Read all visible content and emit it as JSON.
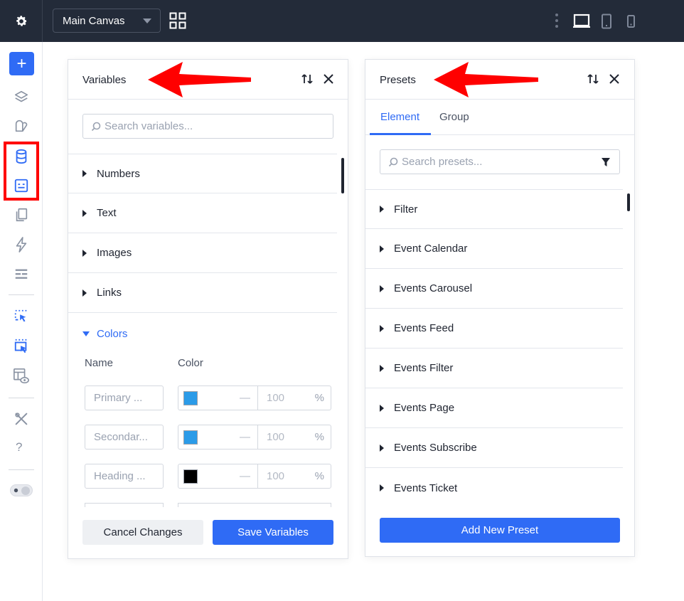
{
  "topbar": {
    "canvas_select": "Main Canvas"
  },
  "sidebar": {
    "add_label": "+",
    "help_label": "?"
  },
  "variables_panel": {
    "title": "Variables",
    "search_placeholder": "Search variables...",
    "sections": [
      "Numbers",
      "Text",
      "Images",
      "Links"
    ],
    "colors_section": "Colors",
    "col_name": "Name",
    "col_color": "Color",
    "rows": [
      {
        "name": "Primary ...",
        "swatch": "#2b9be8",
        "dash": "—",
        "opacity": "100",
        "unit": "%"
      },
      {
        "name": "Secondar...",
        "swatch": "#2b9be8",
        "dash": "—",
        "opacity": "100",
        "unit": "%"
      },
      {
        "name": "Heading ...",
        "swatch": "#000000",
        "dash": "—",
        "opacity": "100",
        "unit": "%"
      }
    ],
    "cancel_label": "Cancel Changes",
    "save_label": "Save Variables"
  },
  "presets_panel": {
    "title": "Presets",
    "tabs": [
      "Element",
      "Group"
    ],
    "search_placeholder": "Search presets...",
    "items": [
      "Filter",
      "Event Calendar",
      "Events Carousel",
      "Events Feed",
      "Events Filter",
      "Events Page",
      "Events Subscribe",
      "Events Ticket"
    ],
    "add_label": "Add New Preset"
  },
  "colors": {
    "accent": "#2f6bf5",
    "topbar": "#232b39",
    "annotation": "#ff0000"
  }
}
